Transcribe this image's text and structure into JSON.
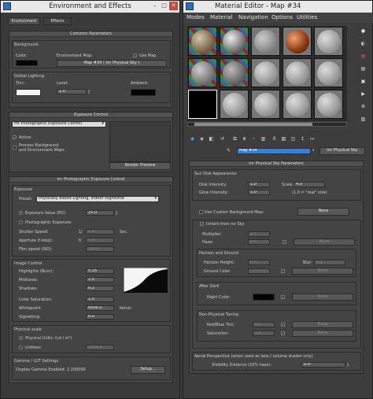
{
  "env": {
    "title": "Environment and Effects",
    "tabs": [
      "Environment",
      "Effects"
    ],
    "common": {
      "header": "Common Parameters",
      "background": "Background:",
      "color": "Color:",
      "env_map": "Environment Map:",
      "use_map": "Use Map",
      "map_button": "Map #34  ( mr Physical Sky )",
      "global_lighting": "Global Lighting:",
      "tint": "Tint:",
      "level": "Level:",
      "level_value": "1.0",
      "ambient": "Ambient:"
    },
    "exposure": {
      "header": "Exposure Control",
      "dropdown": "mr Photographic Exposure Control",
      "active": "Active",
      "process_bg": "Process Background",
      "process_bg2": "and Environment Maps",
      "render_preview": "Render Preview"
    },
    "mr": {
      "header": "mr Photographic Exposure Control",
      "exposure": "Exposure",
      "preset": "Preset:",
      "preset_value": "Physically Based Lighting, Indoor Nighttime",
      "ev": "Exposure Value (EV):",
      "ev_value": "25.0",
      "photographic": "Photographic Exposure:",
      "shutter": "Shutter Speed:",
      "shutter_prefix": "1/",
      "shutter_value": "1.0",
      "sec": "Sec.",
      "aperture": "Aperture (f-stop):",
      "aperture_prefix": "f/",
      "aperture_value": "5.0",
      "film": "Film speed (ISO):",
      "film_value": "100.0",
      "image_control": "Image Control",
      "highlights": "Highlights (Burn):",
      "highlights_value": "0.25",
      "midtones": "Midtones:",
      "midtones_value": "1.0",
      "shadows": "Shadows:",
      "shadows_value": "0.2",
      "saturation": "Color Saturation:",
      "saturation_value": "1.0",
      "whitepoint": "Whitepoint:",
      "whitepoint_value": "6500.0",
      "kelvin": "Kelvin",
      "vignetting": "Vignetting:",
      "vignetting_value": "0.0",
      "physical_scale": "Physical scale",
      "physical_units": "Physical Units: (cd / m²)",
      "unitless": "Unitless",
      "unitless_value": "1500.0",
      "gamma": "Gamma / LUT Settings",
      "display_gamma": "Display Gamma Enabled:  2.200000",
      "setup": "Setup..."
    }
  },
  "mat": {
    "title": "Material Editor - Map #34",
    "menu": [
      "Modes",
      "Material",
      "Navigation",
      "Options",
      "Utilities"
    ],
    "map_name": "Map #34",
    "map_type": "mr Physical Sky",
    "params_header": "mr Physical Sky Parameters",
    "sun_disk": "Sun Disk Appearance",
    "disk_intensity": "Disk Intensity:",
    "disk_intensity_value": "1.0",
    "glow_intensity": "Glow Intensity:",
    "glow_intensity_value": "1.0",
    "scale": "Scale:",
    "scale_value": "4.0",
    "scale_note": "(1.0 = \"real\" size)",
    "custom_bg": "Use Custom Background Map:",
    "none": "None",
    "inherit": "Inherit from mr Sky",
    "multiplier": "Multiplier:",
    "multiplier_value": "1.0",
    "haze": "Haze:",
    "haze_value": "0.0",
    "horizon_group": "Horizon and Ground",
    "horizon_height": "Horizon Height:",
    "horizon_height_value": "0.0",
    "blur": "Blur:",
    "blur_value": "0.1",
    "ground_color": "Ground Color:",
    "after_dark": "After Dark",
    "night_color": "Night Color:",
    "non_physical": "Non-Physical Tuning",
    "red_blue": "Red/Blue Tint:",
    "red_blue_value": "0.0",
    "mat_saturation": "Saturation:",
    "mat_saturation_value": "1.0",
    "aerial": "Aerial Perspective (when used as lens / volume shader only)",
    "visibility": "Visibility Distance (10% haze):",
    "visibility_value": "0.0\""
  },
  "colors": {
    "title_bar": "#e8e8e8",
    "panel_bg": "#444444",
    "accent_blue": "#3a7fd6"
  }
}
